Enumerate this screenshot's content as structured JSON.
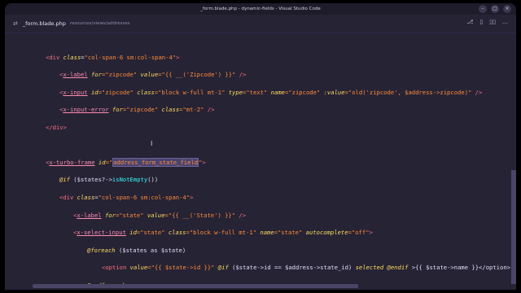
{
  "window": {
    "title": "_form.blade.php - dynamic-fields - Visual Studio Code"
  },
  "controls": {
    "minimize": "–",
    "maximize": "□",
    "close": "×"
  },
  "tab": {
    "icon": "⇄",
    "filename": "_form.blade.php",
    "path": "resources/views/addresses"
  },
  "tab_actions": [
    "⎇",
    "▯",
    "▯▯",
    "…"
  ],
  "code": {
    "l1": {
      "a": "<div ",
      "b": "class",
      "c": "=",
      "d": "\"col-span-6 sm:col-span-4\"",
      "e": ">"
    },
    "l2": {
      "a": "<",
      "b": "x-label",
      "c": " for",
      "d": "=\"zipcode\"",
      "e": " value",
      "f": "=\"{{ __('Zipcode') }}\"",
      "g": " />"
    },
    "l3": {
      "a": "<",
      "b": "x-input",
      "c": " id",
      "d": "=\"zipcode\"",
      "e": " class",
      "f": "=\"block w-full mt-1\"",
      "g": " type",
      "h": "=\"text\"",
      "i": " name",
      "j": "=\"zipcode\"",
      "k": " :value",
      "l": "=\"old('zipcode', $address->zipcode)\"",
      "m": " />"
    },
    "l4": {
      "a": "<",
      "b": "x-input-error",
      "c": " for",
      "d": "=\"zipcode\"",
      "e": " class",
      "f": "=\"mt-2\"",
      "g": " />"
    },
    "l5": {
      "a": "</div>"
    },
    "l6": {
      "a": "<",
      "b": "x-turbo-frame",
      "c": " id",
      "d": "=\"",
      "e": "address_form_state_field",
      "f": "\"",
      "g": ">"
    },
    "l7": {
      "a": "@if",
      "b": " ($states?->",
      "c": "isNotEmpty",
      "d": "())"
    },
    "l8": {
      "a": "<div ",
      "b": "class",
      "c": "=",
      "d": "\"col-span-6 sm:col-span-4\"",
      "e": ">"
    },
    "l9": {
      "a": "<",
      "b": "x-label",
      "c": " for",
      "d": "=\"state\"",
      "e": " value",
      "f": "=\"{{ __('State') }}\"",
      "g": " />"
    },
    "l10": {
      "a": "<",
      "b": "x-select-input",
      "c": " id",
      "d": "=\"state\"",
      "e": " class",
      "f": "=\"block w-full mt-1\"",
      "g": " name",
      "h": "=\"state\"",
      "i": " autocomplete",
      "j": "=\"off\"",
      "k": ">"
    },
    "l11": {
      "a": "@foreach",
      "b": " ($states as $state)"
    },
    "l12": {
      "a": "<option ",
      "b": "value",
      "c": "=\"{{ $state->id }}\"",
      "d": " @if",
      "e": " ($state->id == $address->state_id) ",
      "f": "selected",
      "g": " @endif",
      "h": " >{{ $state->name }}</option>"
    },
    "l13": {
      "a": "@endforeach"
    }
  },
  "colors": {
    "background": "#262335",
    "tag": "#f47280",
    "attribute": "#fede5d",
    "string": "#ff8b39",
    "function": "#36f9f6"
  }
}
